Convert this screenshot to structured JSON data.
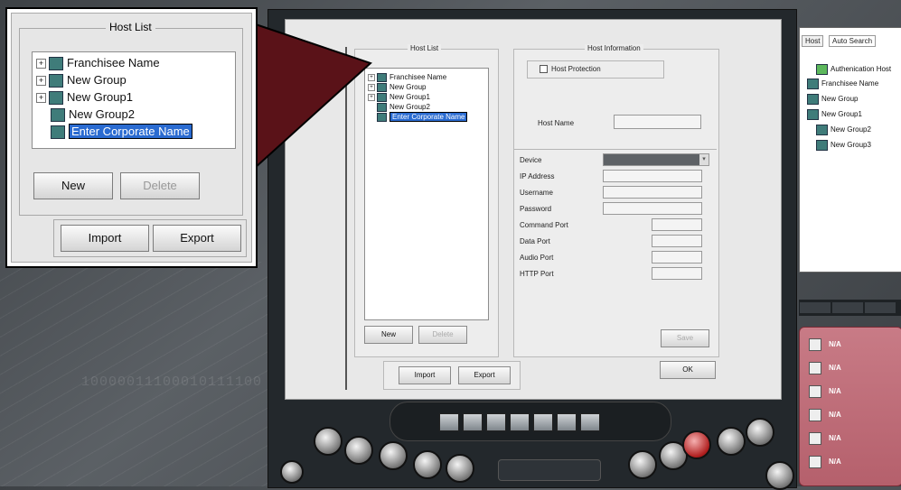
{
  "background": {
    "binary_text": "10000011100010111100"
  },
  "zoom_callout": {
    "title": "Host List",
    "tree": [
      {
        "label": "Franchisee Name",
        "expandable": true
      },
      {
        "label": "New Group",
        "expandable": true
      },
      {
        "label": "New Group1",
        "expandable": true
      },
      {
        "label": "New Group2",
        "expandable": false
      },
      {
        "label": "Enter Corporate Name",
        "expandable": false,
        "editing": true
      }
    ],
    "new_label": "New",
    "delete_label": "Delete",
    "import_label": "Import",
    "export_label": "Export"
  },
  "host_list": {
    "title": "Host List",
    "tree": [
      {
        "label": "Franchisee Name",
        "expandable": true
      },
      {
        "label": "New Group",
        "expandable": true
      },
      {
        "label": "New Group1",
        "expandable": true
      },
      {
        "label": "New Group2",
        "expandable": false
      },
      {
        "label": "Enter Corporate Name",
        "expandable": false,
        "editing": true
      }
    ],
    "new_label": "New",
    "delete_label": "Delete",
    "import_label": "Import",
    "export_label": "Export"
  },
  "host_info": {
    "title": "Host Information",
    "protection_label": "Host Protection",
    "host_name_label": "Host Name",
    "device_label": "Device",
    "ip_label": "IP Address",
    "username_label": "Username",
    "password_label": "Password",
    "command_port_label": "Command Port",
    "data_port_label": "Data Port",
    "audio_port_label": "Audio Port",
    "http_port_label": "HTTP Port",
    "save_label": "Save",
    "ok_label": "OK"
  },
  "right_panel": {
    "tabs": [
      "Host",
      "Auto Search"
    ],
    "tree": [
      {
        "label": "Authenication Host"
      },
      {
        "label": "Franchisee Name"
      },
      {
        "label": "New Group"
      },
      {
        "label": "New Group1"
      },
      {
        "label": "New Group2"
      },
      {
        "label": "New Group3"
      }
    ]
  },
  "status_panel": {
    "rows": [
      "N/A",
      "N/A",
      "N/A",
      "N/A",
      "N/A",
      "N/A"
    ]
  },
  "colors": {
    "accent_selection": "#2a6bd1",
    "callout_arrow": "#5a1218",
    "status_panel": "#b5606c"
  }
}
